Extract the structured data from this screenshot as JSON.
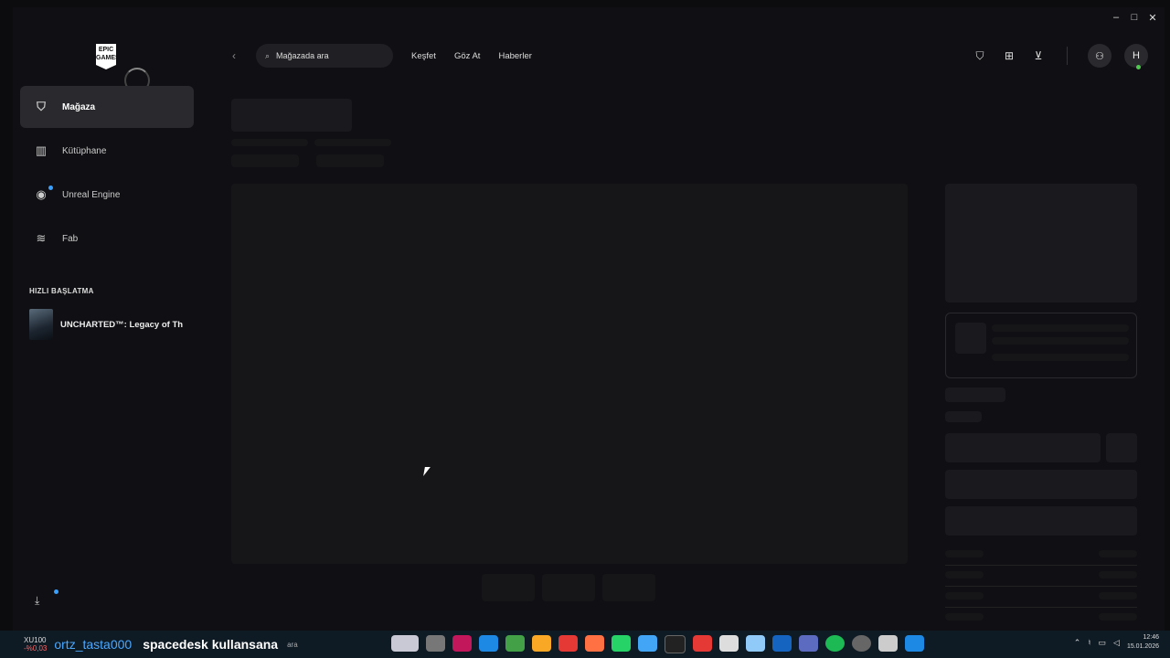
{
  "window": {
    "controls": [
      "–",
      "□",
      "✕"
    ]
  },
  "logo": {
    "text": "EPIC GAMES"
  },
  "sidebar": {
    "items": [
      {
        "label": "Mağaza",
        "icon": "shopping-bag-icon"
      },
      {
        "label": "Kütüphane",
        "icon": "library-icon"
      },
      {
        "label": "Unreal Engine",
        "icon": "unreal-engine-icon"
      },
      {
        "label": "Fab",
        "icon": "fab-icon"
      }
    ],
    "quick_launch_title": "HIZLI BAŞLATMA",
    "quick_launch_item": "UNCHARTED™: Legacy of Th"
  },
  "topbar": {
    "search_placeholder": "Mağazada ara",
    "links": [
      "Keşfet",
      "Göz At",
      "Haberler"
    ],
    "avatar_initial": "H"
  },
  "taskbar": {
    "stock_symbol": "XU100",
    "stock_change": "-%0,03",
    "search_text": "ara",
    "scroll_user": "ortz_tasta000",
    "scroll_message": "spacedesk kullansana",
    "time": "12:46",
    "date": "15.01.2026"
  },
  "colors": {
    "background": "#101014",
    "active_nav": "#2a2a2e",
    "badge_dot": "#3aa0ff",
    "online": "#4fc94f"
  }
}
